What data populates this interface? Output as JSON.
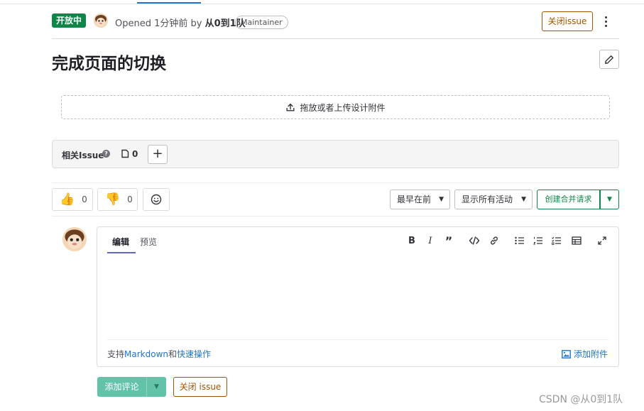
{
  "issue": {
    "status": "开放中",
    "opened_prefix": "Opened 1分钟前 by ",
    "author": "从0到1队",
    "role": "Maintainer",
    "close_label": "关闭issue",
    "title": "完成页面的切换"
  },
  "upload": {
    "label": "拖放或者上传设计附件"
  },
  "related": {
    "label": "相关Issue",
    "help": "?",
    "count": "0",
    "add": "+"
  },
  "reactions": {
    "thumbs_up": "0",
    "thumbs_down": "0"
  },
  "filters": {
    "sort": "最早在前",
    "activity": "显示所有活动",
    "create_mr": "创建合并请求"
  },
  "composer": {
    "tab_write": "编辑",
    "tab_preview": "预览",
    "hint_prefix": "支持",
    "hint_markdown": "Markdown",
    "hint_and": "和",
    "hint_quick": "快速操作",
    "attach": "添加附件"
  },
  "actions": {
    "submit": "添加评论",
    "close": "关闭 issue"
  },
  "watermark": "CSDN @从0到1队",
  "icons": {
    "kebab": "kebab-icon",
    "pencil": "pencil-icon",
    "upload": "upload-icon",
    "issue": "issue-type-icon",
    "smile": "smiley-icon",
    "image": "image-icon"
  },
  "colors": {
    "status": "#108548",
    "close": "#9e5400",
    "link": "#1f75cb",
    "submit": "#63c3a9"
  }
}
